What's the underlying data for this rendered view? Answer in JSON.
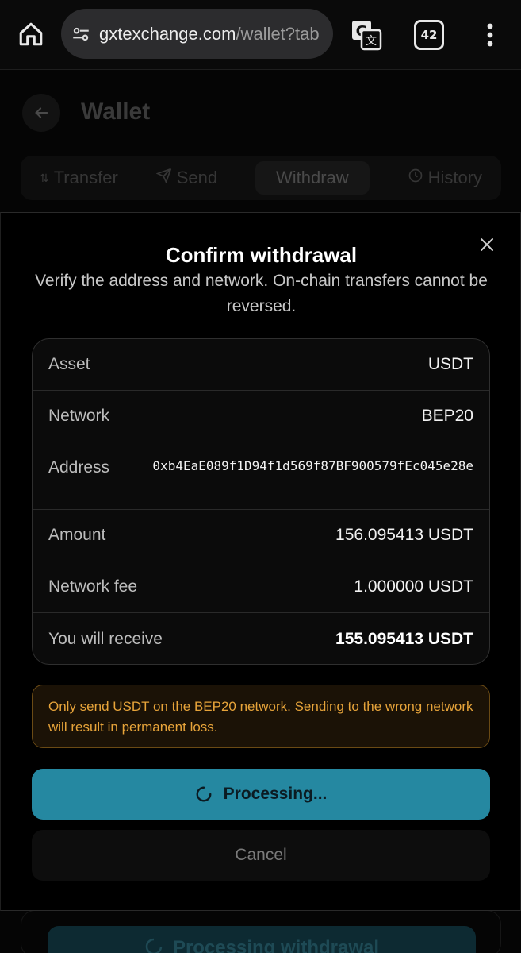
{
  "browser": {
    "url_host": "gxtexchange.com",
    "url_path": "/wallet?tab",
    "tab_count": "42",
    "icons": {
      "home": "home-icon",
      "site_settings": "site-settings-icon",
      "translate": "translate-icon",
      "menu": "more-vert-icon"
    }
  },
  "page": {
    "title": "Wallet",
    "tabs": [
      {
        "label": "Transfer",
        "icon": "transfer-icon"
      },
      {
        "label": "Send",
        "icon": "send-icon"
      },
      {
        "label": "Withdraw",
        "icon": ""
      },
      {
        "label": "History",
        "icon": "clock-icon"
      }
    ],
    "active_tab": "Withdraw",
    "bottom_button_label": "Processing withdrawal"
  },
  "modal": {
    "title": "Confirm withdrawal",
    "subtitle": "Verify the address and network. On-chain transfers cannot be reversed.",
    "rows": [
      {
        "label": "Asset",
        "value": "USDT"
      },
      {
        "label": "Network",
        "value": "BEP20"
      },
      {
        "label": "Address",
        "value": "0xb4EaE089f1D94f1d569f87BF900579fEc045e28e"
      },
      {
        "label": "Amount",
        "value": "156.095413 USDT"
      },
      {
        "label": "Network fee",
        "value": "1.000000 USDT"
      },
      {
        "label": "You will receive",
        "value": "155.095413 USDT"
      }
    ],
    "warning": "Only send USDT on the BEP20 network. Sending to the wrong network will result in permanent loss.",
    "primary_button": "Processing...",
    "cancel_button": "Cancel"
  },
  "colors": {
    "accent": "#2588a1",
    "warning_text": "#e7a43a",
    "warning_bg": "#1b1206"
  }
}
